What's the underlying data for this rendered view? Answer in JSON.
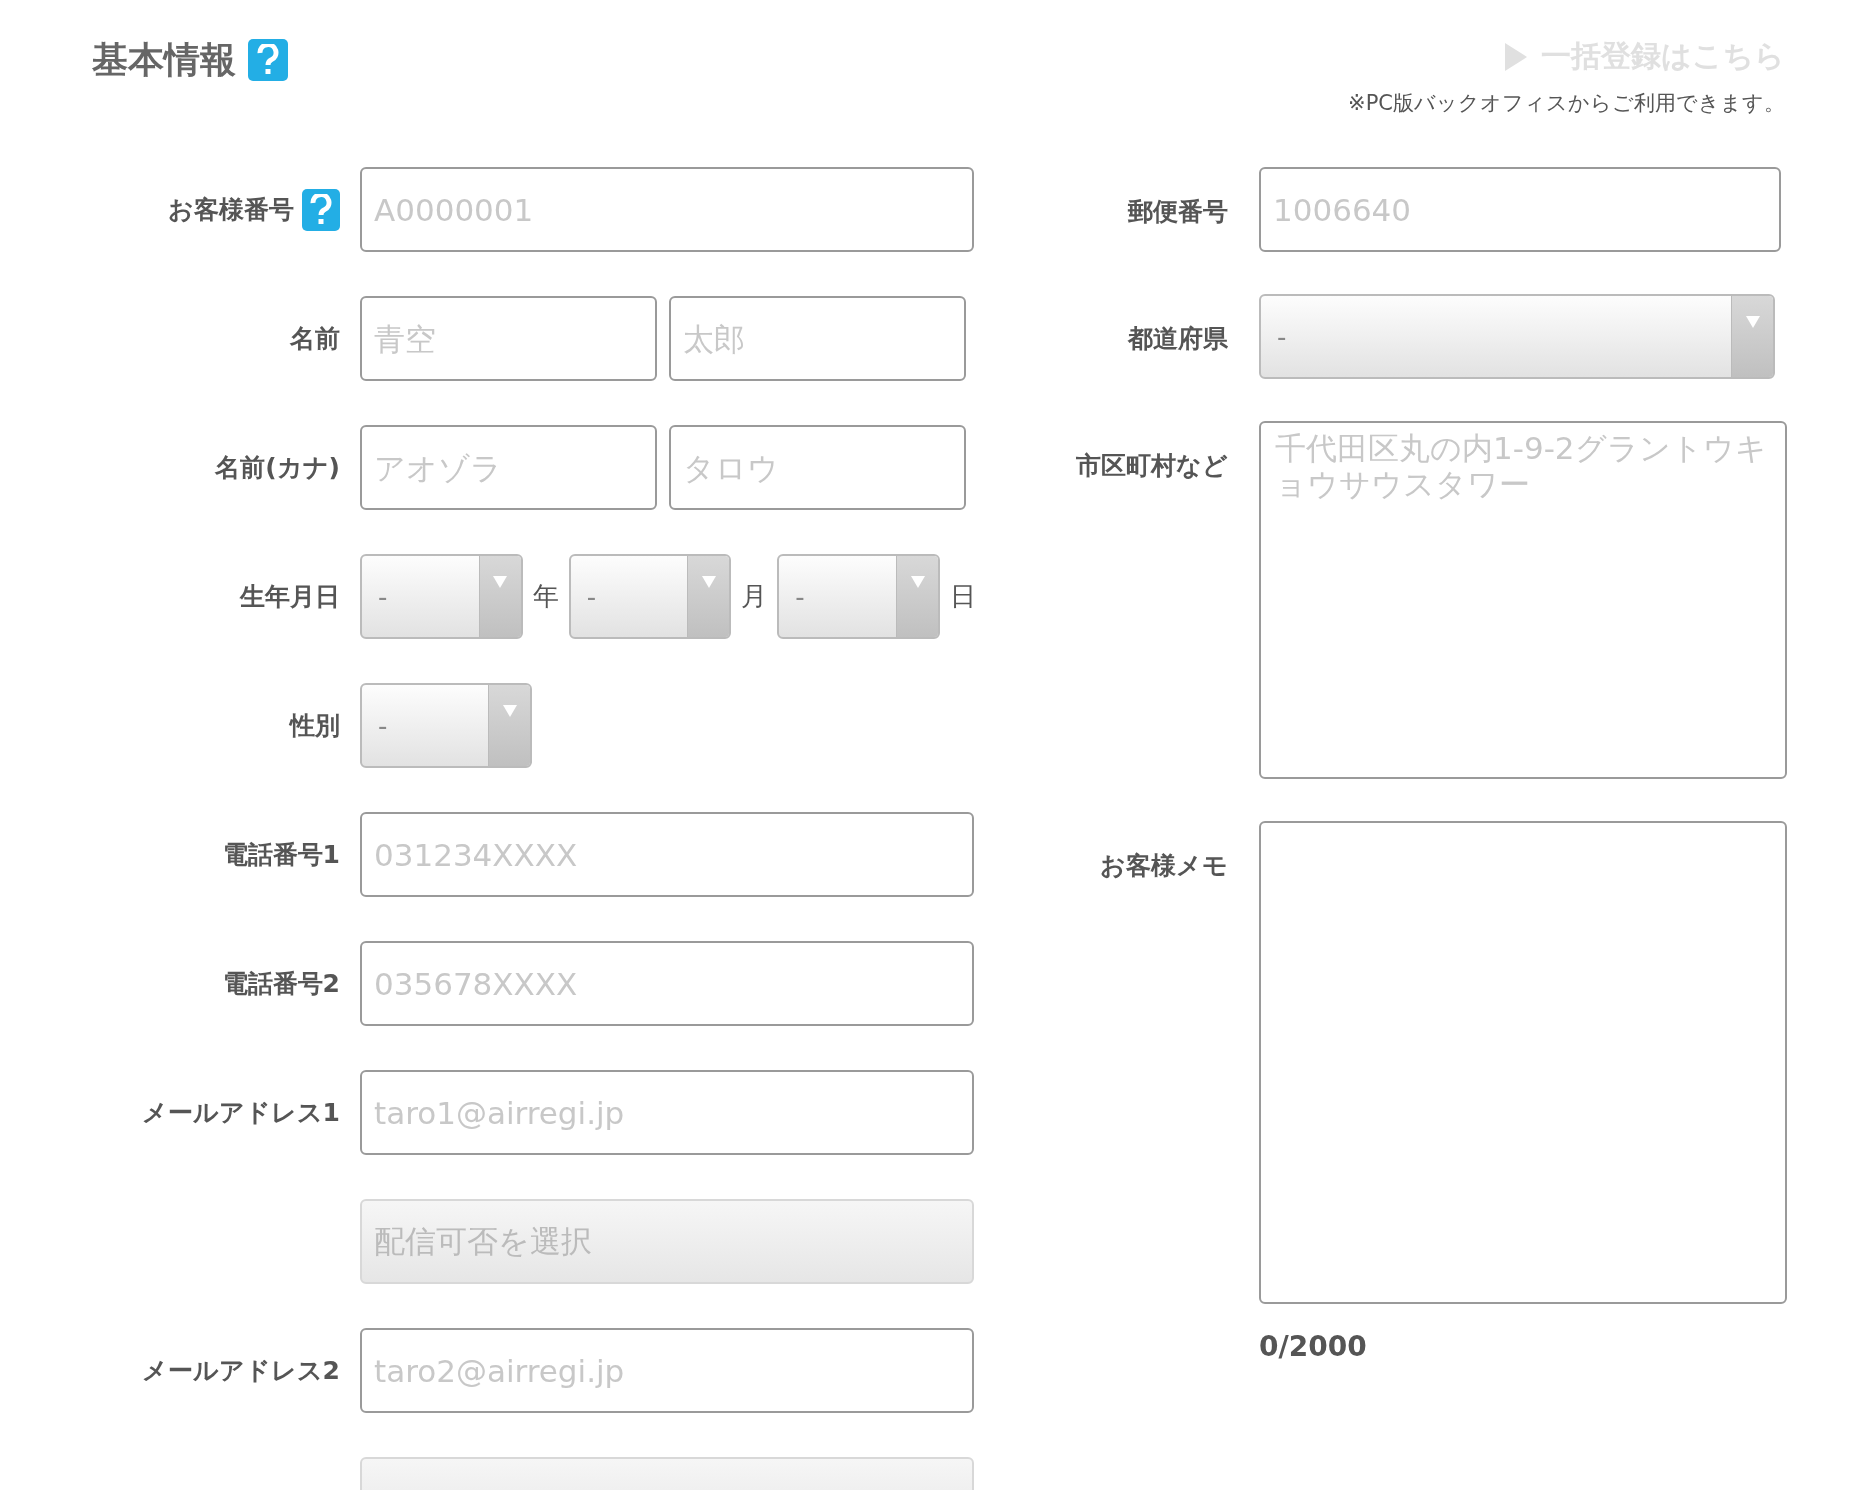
{
  "header": {
    "title": "基本情報",
    "help": true,
    "bulk_link": "一括登録はこちら",
    "note": "※PC版バックオフィスからご利用できます。"
  },
  "left_fields": [
    {
      "kind": "text",
      "label": "お客様番号",
      "help": true,
      "inputs": [
        {
          "placeholder": "A0000001"
        }
      ]
    },
    {
      "kind": "text",
      "label": "名前",
      "inputs": [
        {
          "placeholder": "青空"
        },
        {
          "placeholder": "太郎"
        }
      ]
    },
    {
      "kind": "text",
      "label": "名前(カナ)",
      "inputs": [
        {
          "placeholder": "アオゾラ"
        },
        {
          "placeholder": "タロウ"
        }
      ]
    },
    {
      "kind": "date",
      "label": "生年月日",
      "selects": [
        {
          "value": "-",
          "unit": "年"
        },
        {
          "value": "-",
          "unit": "月"
        },
        {
          "value": "-",
          "unit": "日"
        }
      ]
    },
    {
      "kind": "select",
      "label": "性別",
      "selects": [
        {
          "value": "-"
        }
      ]
    },
    {
      "kind": "text",
      "label": "電話番号1",
      "inputs": [
        {
          "placeholder": "031234XXXX"
        }
      ]
    },
    {
      "kind": "text",
      "label": "電話番号2",
      "inputs": [
        {
          "placeholder": "035678XXXX"
        }
      ]
    },
    {
      "kind": "text",
      "label": "メールアドレス1",
      "inputs": [
        {
          "placeholder": "taro1@airregi.jp"
        }
      ]
    },
    {
      "kind": "option",
      "disabled": true,
      "placeholder": "配信可否を選択"
    },
    {
      "kind": "text",
      "label": "メールアドレス2",
      "inputs": [
        {
          "placeholder": "taro2@airregi.jp"
        }
      ]
    },
    {
      "kind": "option",
      "disabled": true
    }
  ],
  "right_fields": [
    {
      "kind": "text",
      "label": "郵便番号",
      "placeholder": "1006640"
    },
    {
      "kind": "select",
      "label": "都道府県",
      "value": "-"
    },
    {
      "kind": "textarea",
      "label": "市区町村など",
      "placeholder": "千代田区丸の内1-9-2グラントウキョウサウスタワー"
    },
    {
      "kind": "memo",
      "label": "お客様メモ",
      "counter": "0/2000"
    }
  ]
}
